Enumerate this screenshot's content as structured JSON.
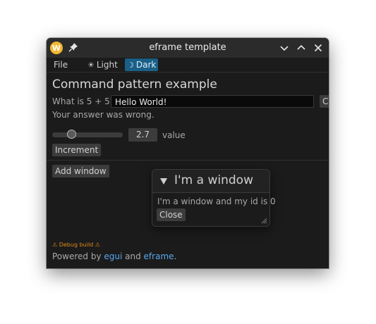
{
  "titlebar": {
    "app_icon_letter": "W",
    "app_icon": "app-logo-icon",
    "pin_icon": "pin-icon",
    "title": "eframe template",
    "buttons": [
      "minimize-chevron-icon",
      "maximize-chevron-icon",
      "close-icon"
    ]
  },
  "menubar": {
    "file": "File",
    "light": "Light",
    "light_glyph": "☀",
    "dark": "Dark",
    "dark_glyph": "☽"
  },
  "main": {
    "heading": "Command pattern example",
    "question_label": "What is 5 + 5?",
    "answer_value": "Hello World!",
    "clipped_button_label": "C",
    "feedback": "Your answer was wrong.",
    "slider_value": "2.7",
    "slider_fraction": 0.27,
    "slider_label": "value",
    "increment_label": "Increment",
    "add_window_label": "Add window"
  },
  "subwindow": {
    "title": "I'm a window",
    "body": "I'm a window and my id is 0",
    "close_label": "Close"
  },
  "footer": {
    "debug": "⚠ Debug build ⚠",
    "powered_prefix": "Powered by ",
    "egui": "egui",
    "and": " and ",
    "eframe": "eframe",
    "period": "."
  },
  "colors": {
    "background": "#1b1b1b",
    "accent": "#1a5f87",
    "link": "#5aa8ee",
    "warning": "#e08a16"
  }
}
